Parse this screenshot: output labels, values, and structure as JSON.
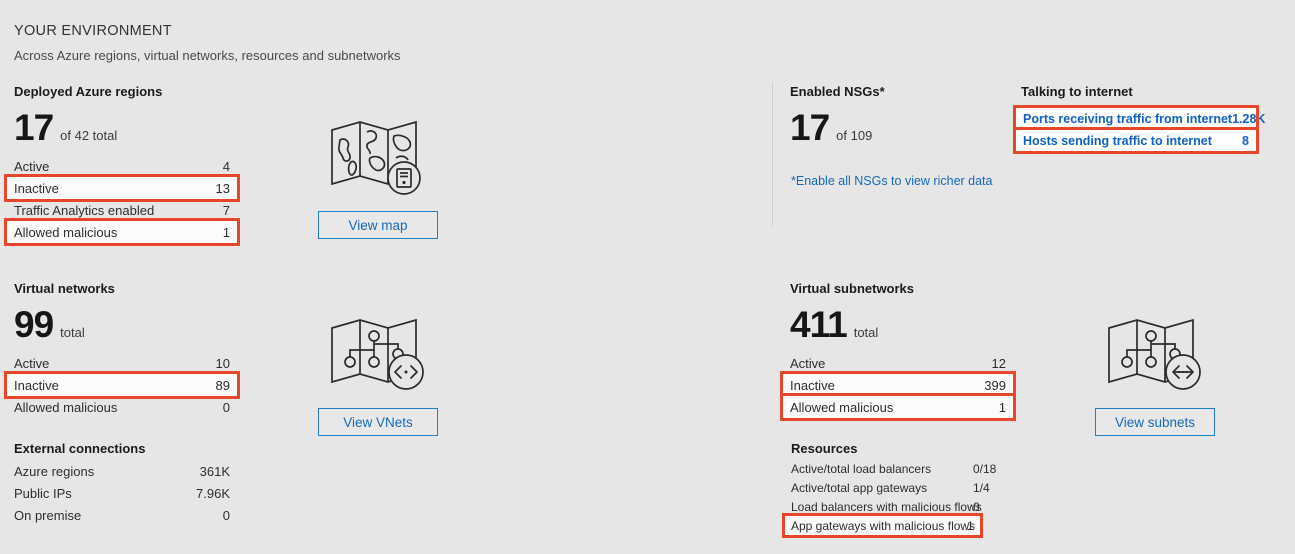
{
  "header": {
    "title": "YOUR ENVIRONMENT",
    "subtitle": "Across Azure regions, virtual networks, resources and subnetworks"
  },
  "regions": {
    "title": "Deployed Azure regions",
    "big_number": "17",
    "big_suffix": "of 42 total",
    "rows": [
      {
        "label": "Active",
        "value": "4",
        "highlight": false
      },
      {
        "label": "Inactive",
        "value": "13",
        "highlight": true
      },
      {
        "label": "Traffic Analytics enabled",
        "value": "7",
        "highlight": false
      },
      {
        "label": "Allowed malicious",
        "value": "1",
        "highlight": true
      }
    ],
    "button": "View map",
    "icon": "world-map-server-icon"
  },
  "vnets": {
    "title": "Virtual networks",
    "big_number": "99",
    "big_suffix": "total",
    "rows": [
      {
        "label": "Active",
        "value": "10",
        "highlight": false
      },
      {
        "label": "Inactive",
        "value": "89",
        "highlight": true
      },
      {
        "label": "Allowed malicious",
        "value": "0",
        "highlight": false
      }
    ],
    "button": "View VNets",
    "icon": "map-network-code-icon"
  },
  "external": {
    "title": "External connections",
    "rows": [
      {
        "label": "Azure regions",
        "value": "361K"
      },
      {
        "label": "Public IPs",
        "value": "7.96K"
      },
      {
        "label": "On premise",
        "value": "0"
      }
    ]
  },
  "nsgs": {
    "title": "Enabled NSGs*",
    "big_number": "17",
    "big_suffix": "of 109",
    "footnote": "*Enable all NSGs to view richer data"
  },
  "internet": {
    "title": "Talking to internet",
    "rows": [
      {
        "label": "Ports receiving traffic from internet",
        "value": "1.28K"
      },
      {
        "label": "Hosts sending traffic to internet",
        "value": "8"
      }
    ]
  },
  "subnets": {
    "title": "Virtual subnetworks",
    "big_number": "411",
    "big_suffix": "total",
    "rows": [
      {
        "label": "Active",
        "value": "12",
        "highlight": false
      },
      {
        "label": "Inactive",
        "value": "399",
        "highlight": true
      },
      {
        "label": "Allowed malicious",
        "value": "1",
        "highlight": true
      }
    ],
    "button": "View subnets",
    "icon": "map-network-subnet-icon"
  },
  "resources": {
    "title": "Resources",
    "rows": [
      {
        "label": "Active/total load balancers",
        "value": "0/18",
        "highlight": false
      },
      {
        "label": "Active/total app gateways",
        "value": "1/4",
        "highlight": false
      },
      {
        "label": "Load balancers with malicious flows",
        "value": "0",
        "highlight": false
      },
      {
        "label": "App gateways with malicious flows",
        "value": "1",
        "highlight": true
      }
    ]
  },
  "colors": {
    "background": "#e6e6e6",
    "accent_blue": "#1668b8",
    "highlight_red": "#e8462a",
    "text": "#1f1f1f"
  }
}
